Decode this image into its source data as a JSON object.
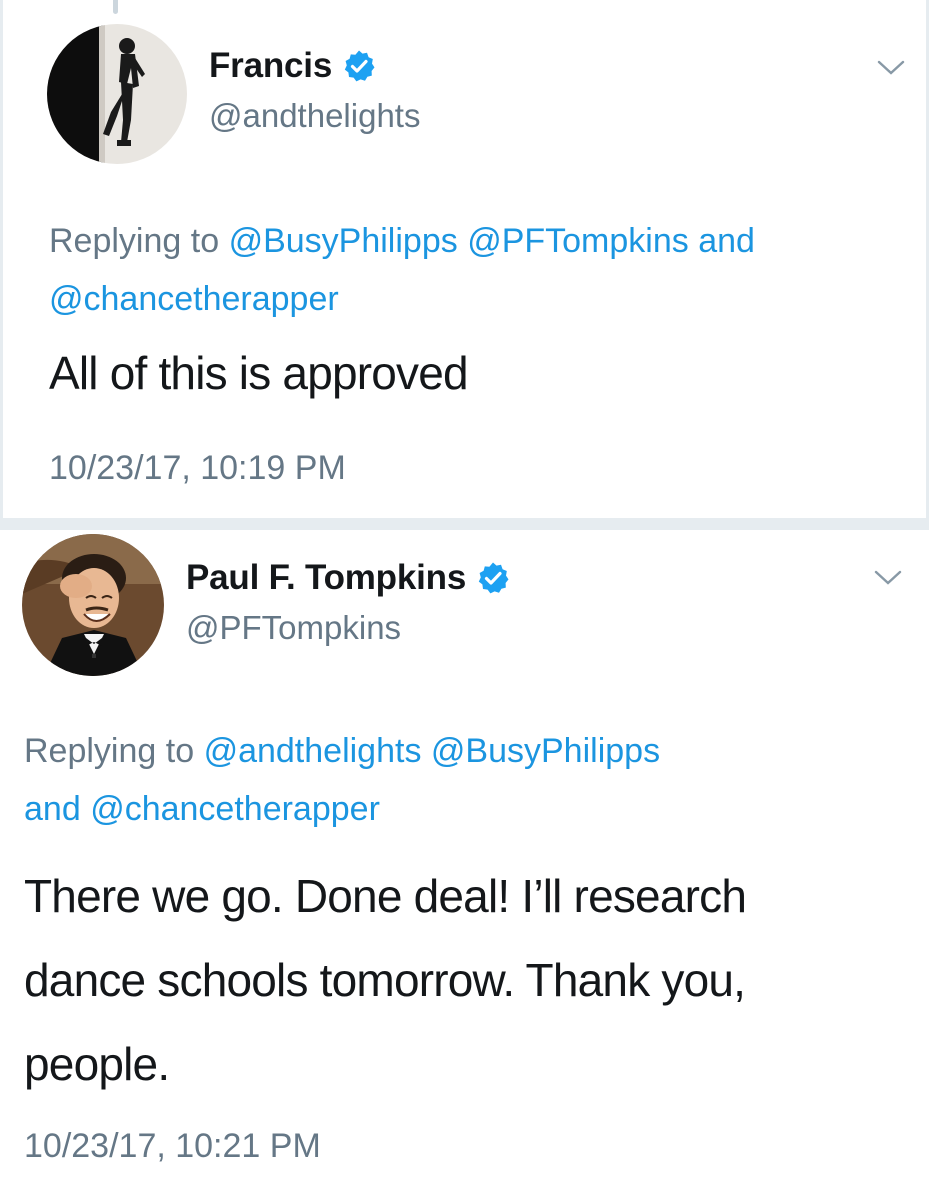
{
  "colors": {
    "link": "#1b95e0",
    "secondary_text": "#657786",
    "primary_text": "#14171a",
    "verified_badge": "#1da1f2",
    "divider": "#e6ecf0"
  },
  "tweets": [
    {
      "display_name": "Francis",
      "handle": "@andthelights",
      "verified": true,
      "avatar_icon": "profile-photo-dancer",
      "menu_icon": "chevron-down-icon",
      "replying_prefix": "Replying to",
      "mentions": [
        "@BusyPhilipps",
        "@PFTompkins"
      ],
      "conjunction": "and",
      "last_mention": "@chancetherapper",
      "text": "All of this is approved",
      "timestamp": "10/23/17, 10:19 PM"
    },
    {
      "display_name": "Paul F. Tompkins",
      "handle": "@PFTompkins",
      "verified": true,
      "avatar_icon": "profile-photo-laughing-man",
      "menu_icon": "chevron-down-icon",
      "replying_prefix": "Replying to",
      "mentions": [
        "@andthelights",
        "@BusyPhilipps"
      ],
      "conjunction": "and",
      "last_mention": "@chancetherapper",
      "text_lines": [
        "There we go. Done deal! I’ll research",
        "dance schools tomorrow. Thank you,",
        "people."
      ],
      "timestamp": "10/23/17, 10:21 PM"
    }
  ]
}
